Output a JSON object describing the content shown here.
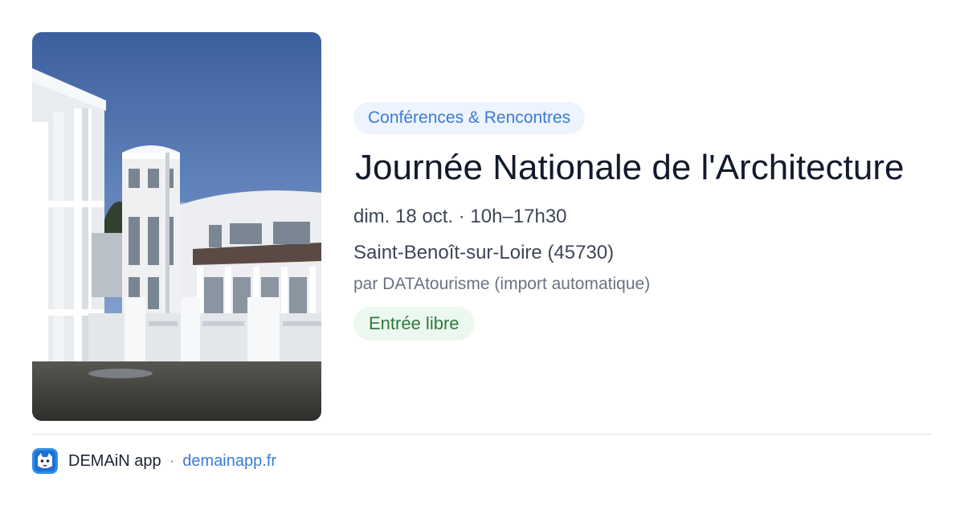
{
  "event": {
    "image_alt": "Bâtiment blanc de style Art déco",
    "category": "Conférences & Rencontres",
    "title": "Journée Nationale de l'Architecture",
    "datetime": "dim. 18 oct. · 10h–17h30",
    "location": "Saint-Benoît-sur-Loire (45730)",
    "organizer": "par DATAtourisme (import automatique)",
    "price": "Entrée libre"
  },
  "footer": {
    "app_name": "DEMAiN app",
    "separator": "·",
    "site": "demainapp.fr",
    "logo_icon": "demain-logo-icon"
  },
  "colors": {
    "category_text": "#3d7bd6",
    "category_bg": "#eef4fd",
    "price_text": "#2f7a3e",
    "price_bg": "#ecf8ef",
    "link": "#3d7bd6",
    "title": "#121a2b"
  }
}
